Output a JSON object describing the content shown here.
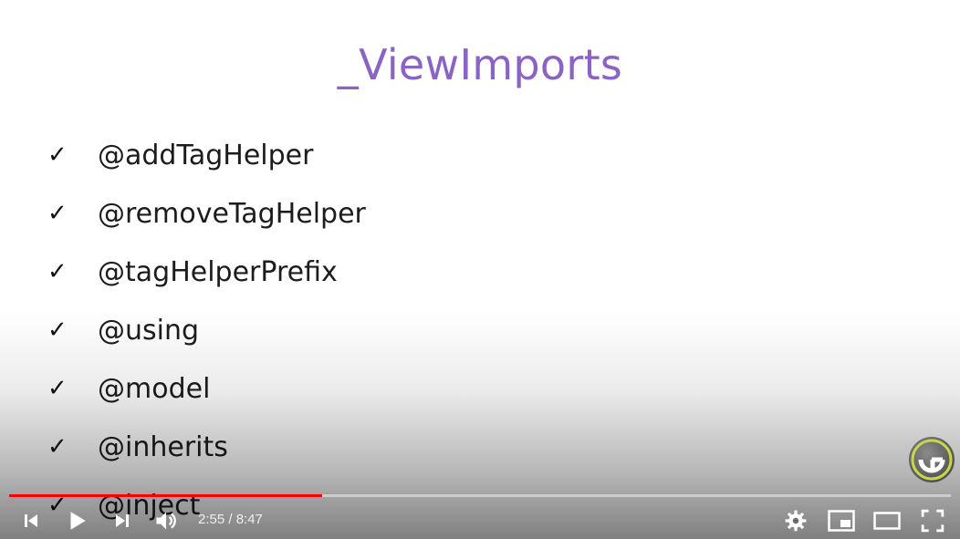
{
  "slide": {
    "title": "_ViewImports",
    "bullets": [
      {
        "check": "✓",
        "text": "@addTagHelper"
      },
      {
        "check": "✓",
        "text": "@removeTagHelper"
      },
      {
        "check": "✓",
        "text": "@tagHelperPrefix"
      },
      {
        "check": "✓",
        "text": "@using"
      },
      {
        "check": "✓",
        "text": "@model"
      },
      {
        "check": "✓",
        "text": "@inherits"
      },
      {
        "check": "✓",
        "text": "@inject"
      }
    ]
  },
  "player": {
    "current_time": "2:55",
    "duration": "8:47",
    "time_display": "2:55 / 8:47",
    "progress_fraction": 0.332,
    "colors": {
      "played": "#ff0000",
      "title": "#8a63c4"
    },
    "icons": {
      "previous": "skip-previous-icon",
      "play": "play-icon",
      "next": "skip-next-icon",
      "volume": "volume-icon",
      "settings": "gear-icon",
      "miniplayer": "miniplayer-icon",
      "theater": "theater-mode-icon",
      "fullscreen": "fullscreen-icon",
      "channel_logo": "channel-logo-icon"
    }
  }
}
